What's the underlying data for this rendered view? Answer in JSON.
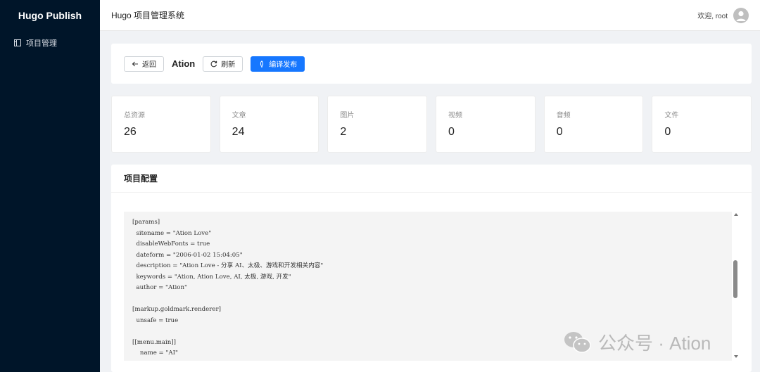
{
  "app": {
    "brand": "Hugo Publish",
    "header_title": "Hugo 项目管理系统",
    "welcome": "欢迎, root"
  },
  "sidebar": {
    "items": [
      {
        "label": "项目管理",
        "icon": "project-icon"
      }
    ]
  },
  "toolbar": {
    "back_label": "返回",
    "project_name": "Ation",
    "refresh_label": "刷新",
    "publish_label": "编译发布"
  },
  "stats": [
    {
      "label": "总资源",
      "value": "26"
    },
    {
      "label": "文章",
      "value": "24"
    },
    {
      "label": "图片",
      "value": "2"
    },
    {
      "label": "视频",
      "value": "0"
    },
    {
      "label": "音频",
      "value": "0"
    },
    {
      "label": "文件",
      "value": "0"
    }
  ],
  "config": {
    "title": "项目配置",
    "code": "[params]\n  sitename = \"Ation Love\"\n  disableWebFonts = true\n  dateform = \"2006-01-02 15:04:05\"\n  description = \"Ation Love - 分享 AI、太极、游戏和开发相关内容\"\n  keywords = \"Ation, Ation Love, AI, 太极, 游戏, 开发\"\n  author = \"Ation\"\n\n[markup.goldmark.renderer]\n  unsafe = true\n\n[[menu.main]]\n    name = \"AI\""
  },
  "watermark": {
    "text": "公众号 · Ation",
    "icon": "wechat-icon"
  },
  "colors": {
    "sidebar_bg": "#001529",
    "primary": "#1677ff"
  }
}
